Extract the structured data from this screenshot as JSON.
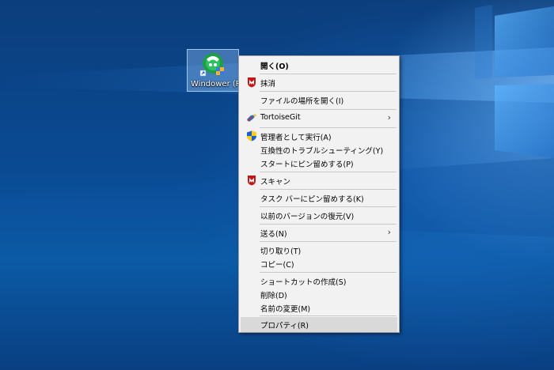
{
  "desktop": {
    "icon": {
      "label": "Windower (RO",
      "icon": "windower-app-icon"
    }
  },
  "context_menu": {
    "items": [
      {
        "label": "開く(O)"
      },
      {
        "label": "抹消",
        "icon": "mcafee-shield-icon"
      },
      {
        "label": "ファイルの場所を開く(I)"
      },
      {
        "label": "TortoiseGit",
        "icon": "tortoisegit-icon",
        "submenu": true
      },
      {
        "label": "管理者として実行(A)",
        "icon": "uac-shield-icon"
      },
      {
        "label": "互換性のトラブルシューティング(Y)"
      },
      {
        "label": "スタートにピン留めする(P)"
      },
      {
        "label": "スキャン",
        "icon": "mcafee-shield-icon"
      },
      {
        "label": "タスク バーにピン留めする(K)"
      },
      {
        "label": "以前のバージョンの復元(V)"
      },
      {
        "label": "送る(N)",
        "submenu": true
      },
      {
        "label": "切り取り(T)"
      },
      {
        "label": "コピー(C)"
      },
      {
        "label": "ショートカットの作成(S)"
      },
      {
        "label": "削除(D)"
      },
      {
        "label": "名前の変更(M)"
      },
      {
        "label": "プロパティ(R)",
        "highlighted": true
      }
    ],
    "chevron": "›"
  },
  "colors": {
    "menu_bg": "#f2f2f2",
    "highlight": "#d9d9d9",
    "mcafee_red": "#c01818"
  }
}
